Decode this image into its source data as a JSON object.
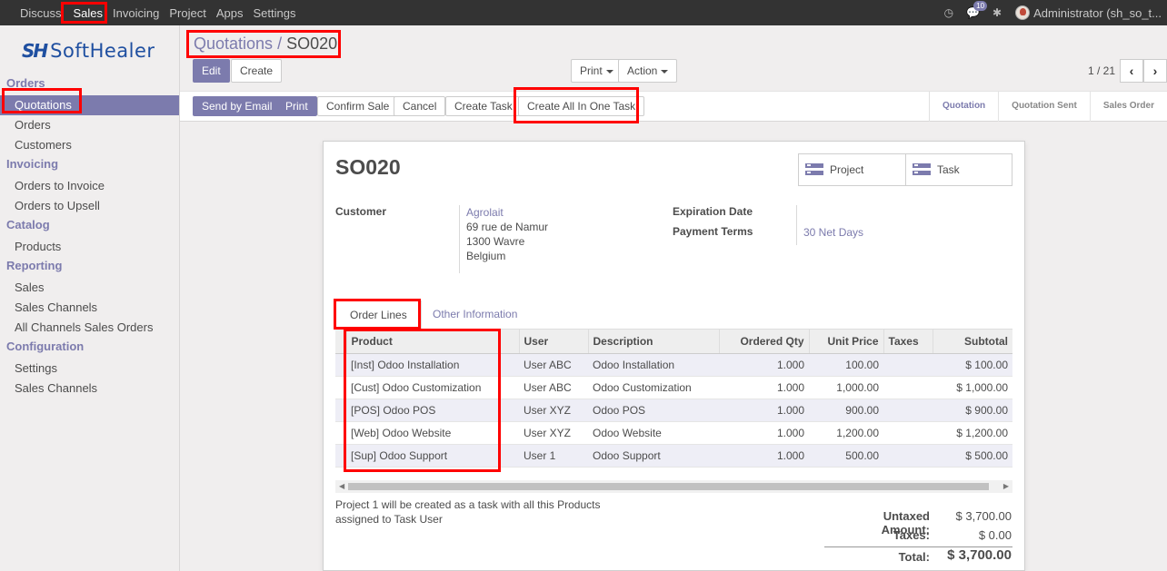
{
  "topbar": {
    "menu": [
      "Discuss",
      "Sales",
      "Invoicing",
      "Project",
      "Apps",
      "Settings"
    ],
    "active": "Sales",
    "message_count": "10",
    "user": "Administrator (sh_so_t..."
  },
  "logo": {
    "mark": "SH",
    "word": "SoftHealer"
  },
  "sidebar": {
    "sections": [
      {
        "title": "Orders",
        "items": [
          "Quotations",
          "Orders",
          "Customers"
        ]
      },
      {
        "title": "Invoicing",
        "items": [
          "Orders to Invoice",
          "Orders to Upsell"
        ]
      },
      {
        "title": "Catalog",
        "items": [
          "Products"
        ]
      },
      {
        "title": "Reporting",
        "items": [
          "Sales",
          "Sales Channels",
          "All Channels Sales Orders"
        ]
      },
      {
        "title": "Configuration",
        "items": [
          "Settings",
          "Sales Channels"
        ]
      }
    ]
  },
  "breadcrumb": {
    "parent": "Quotations",
    "separator": "/",
    "current": "SO020"
  },
  "buttons": {
    "edit": "Edit",
    "create": "Create",
    "print_menu": "Print",
    "action_menu": "Action",
    "send_email": "Send by Email",
    "print": "Print",
    "confirm": "Confirm Sale",
    "cancel": "Cancel",
    "create_task": "Create Task",
    "create_all_task": "Create All In One Task"
  },
  "pager": {
    "text": "1 / 21"
  },
  "stages": [
    "Quotation",
    "Quotation Sent",
    "Sales Order"
  ],
  "record": {
    "name": "SO020",
    "smart_buttons": [
      "Project",
      "Task"
    ],
    "customer_label": "Customer",
    "customer_name": "Agrolait",
    "address": [
      "69 rue de Namur",
      "1300 Wavre",
      "Belgium"
    ],
    "expiration_label": "Expiration Date",
    "payment_label": "Payment Terms",
    "payment_value": "30 Net Days"
  },
  "tabs": [
    "Order Lines",
    "Other Information"
  ],
  "lines": {
    "headers": [
      "Product",
      "User",
      "Description",
      "Ordered Qty",
      "Unit Price",
      "Taxes",
      "Subtotal"
    ],
    "rows": [
      [
        "[Inst] Odoo Installation",
        "User ABC",
        "Odoo Installation",
        "1.000",
        "100.00",
        "",
        "$ 100.00"
      ],
      [
        "[Cust] Odoo Customization",
        "User ABC",
        "Odoo Customization",
        "1.000",
        "1,000.00",
        "",
        "$ 1,000.00"
      ],
      [
        "[POS] Odoo POS",
        "User XYZ",
        "Odoo POS",
        "1.000",
        "900.00",
        "",
        "$ 900.00"
      ],
      [
        "[Web] Odoo Website",
        "User XYZ",
        "Odoo Website",
        "1.000",
        "1,200.00",
        "",
        "$ 1,200.00"
      ],
      [
        "[Sup] Odoo Support",
        "User 1",
        "Odoo Support",
        "1.000",
        "500.00",
        "",
        "$ 500.00"
      ]
    ]
  },
  "note": "Project 1 will be created as  a task with all this Products\nassigned to Task User",
  "totals": {
    "untaxed_label": "Untaxed Amount:",
    "untaxed": "$ 3,700.00",
    "taxes_label": "Taxes:",
    "taxes": "$ 0.00",
    "total_label": "Total:",
    "total": "$ 3,700.00"
  }
}
